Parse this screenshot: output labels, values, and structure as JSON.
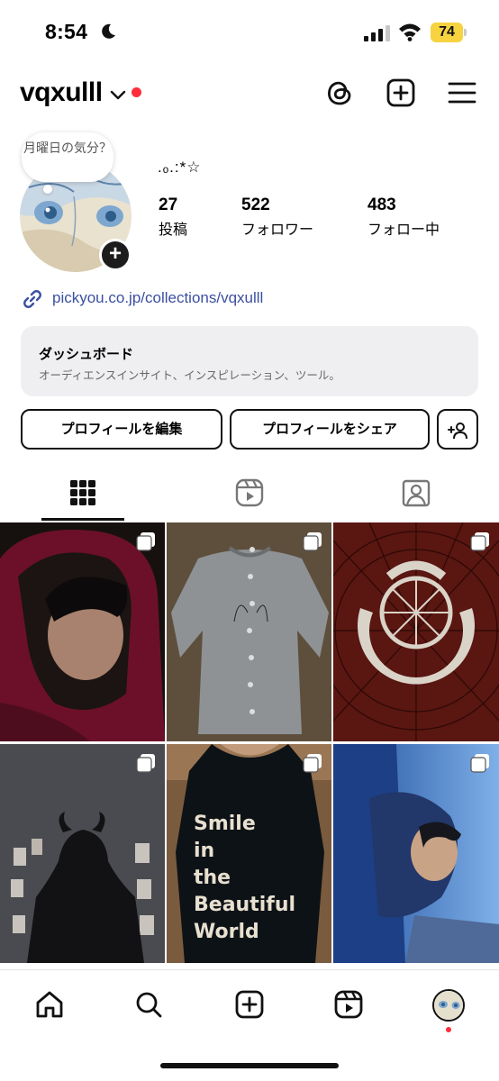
{
  "status_bar": {
    "time": "8:54",
    "battery": "74",
    "battery_color": "#f6d33f"
  },
  "header": {
    "username": "vqxulll",
    "icons": [
      "threads-icon",
      "create-post-icon",
      "menu-icon"
    ]
  },
  "profile": {
    "note": "月曜日の気分？",
    "display_name": ".ₒ.:*☆",
    "stats": [
      {
        "value": "27",
        "label": "投稿"
      },
      {
        "value": "522",
        "label": "フォロワー"
      },
      {
        "value": "483",
        "label": "フォロー中"
      }
    ],
    "link": "pickyou.co.jp/collections/vqxulll",
    "link_color": "#3b4fa0"
  },
  "dashboard": {
    "title": "ダッシュボード",
    "subtitle": "オーディエンスインサイト、インスピレーション、ツール。"
  },
  "actions": {
    "edit_profile": "プロフィールを編集",
    "share_profile": "プロフィールをシェア"
  },
  "text_in_image": {
    "shirt_print": "Smile in the Beautiful World"
  },
  "tabs": [
    "grid-tab",
    "reels-tab",
    "tagged-tab"
  ],
  "grid": [
    {
      "subject": "person in red hoodie"
    },
    {
      "subject": "grey knit sweater"
    },
    {
      "subject": "circular emblem on red pattern"
    },
    {
      "subject": "silhouette with horns, photos on wall"
    },
    {
      "subject": "t-shirt print"
    },
    {
      "subject": "person lying on ground, blue sky"
    }
  ],
  "bottom_nav": [
    "home-icon",
    "search-icon",
    "create-icon",
    "reels-icon",
    "profile-avatar"
  ]
}
